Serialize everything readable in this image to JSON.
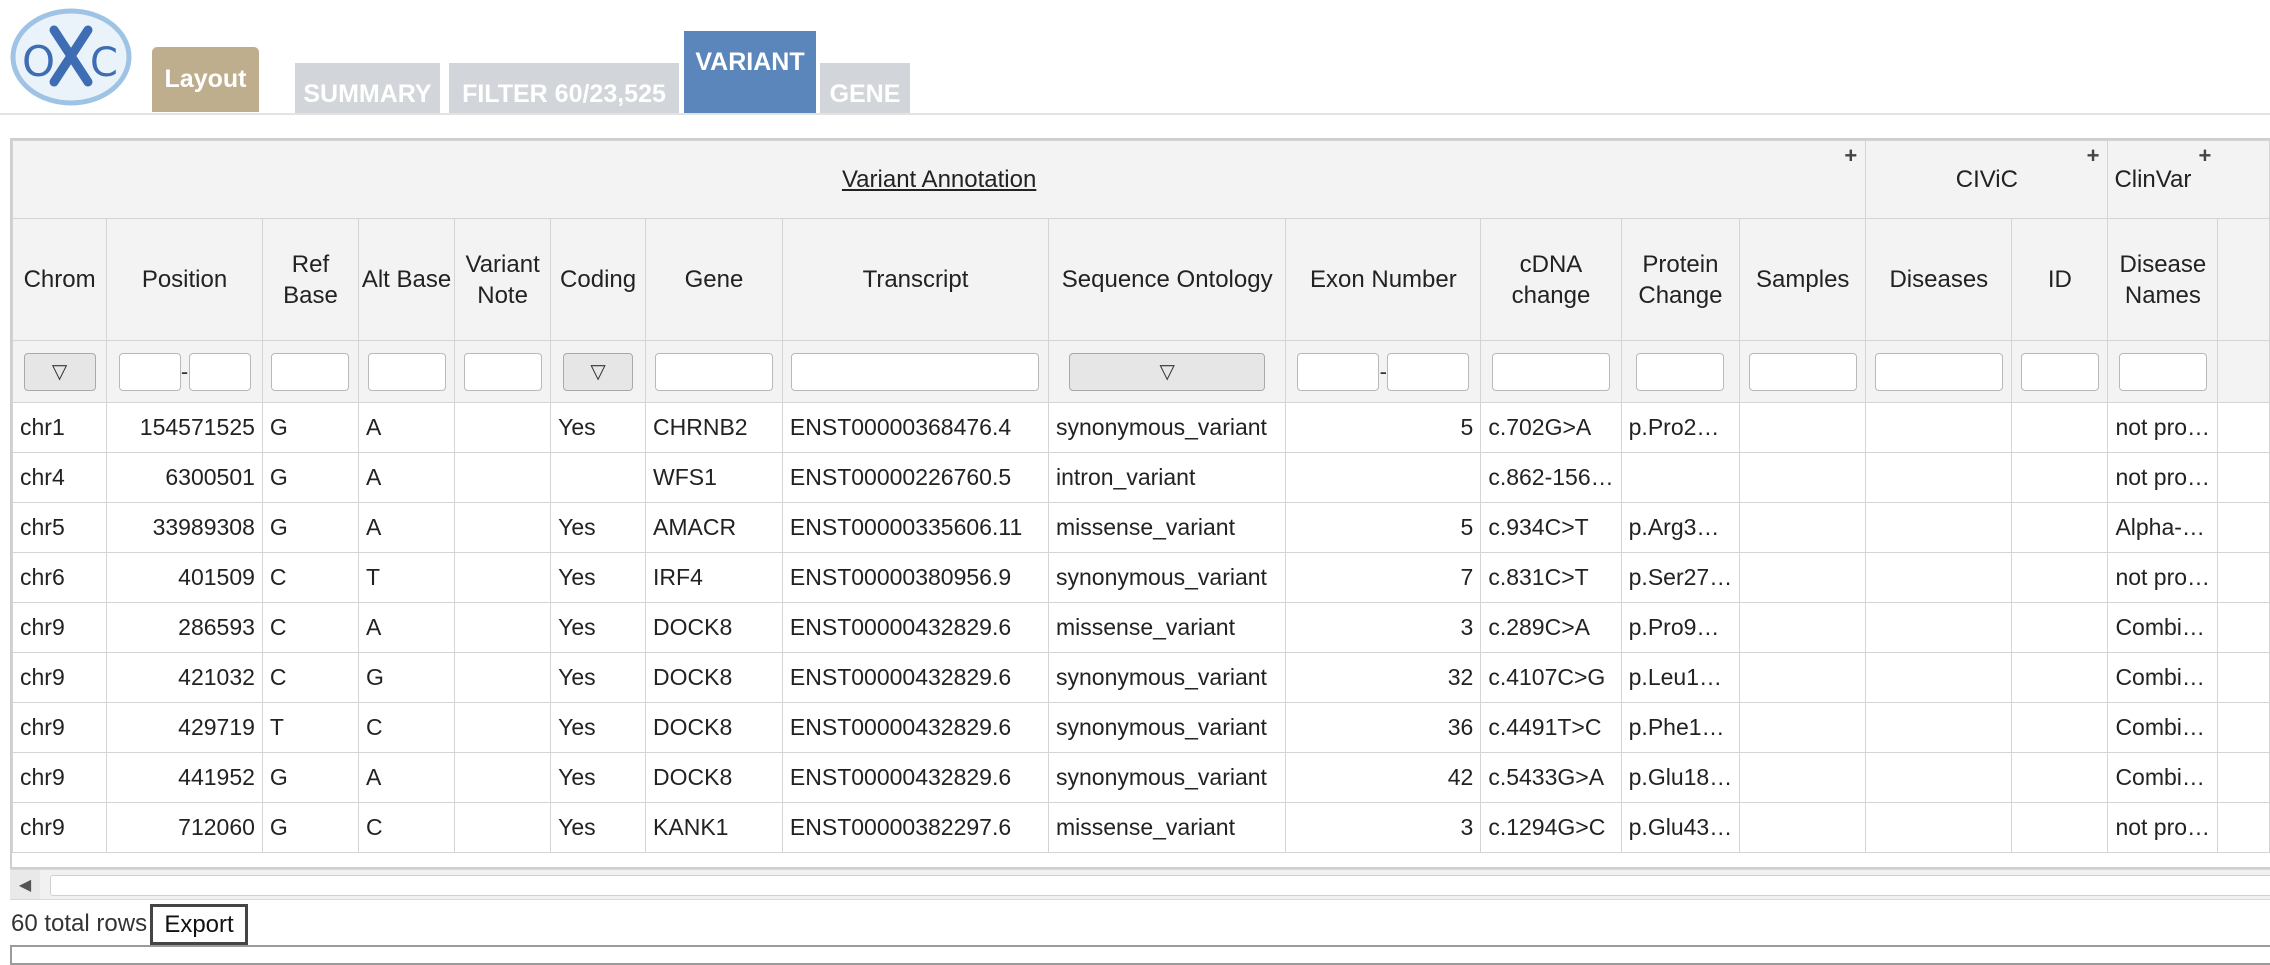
{
  "tabs": {
    "layout": "Layout",
    "summary": "SUMMARY",
    "filter": "FILTER 60/23,525",
    "variant": "VARIANT",
    "gene": "GENE"
  },
  "colors": {
    "layout_tab": "#bfae8e",
    "active_tab": "#5a86bb",
    "inactive_tab": "#d2d5d9",
    "logo_accent": "#3e6db3"
  },
  "groups": {
    "variant_annotation": "Variant Annotation",
    "civic": "CIViC",
    "clinvar": "ClinVar",
    "expand_icon": "+"
  },
  "columns": {
    "chrom": "Chrom",
    "position": "Position",
    "ref_base": "Ref Base",
    "alt_base": "Alt Base",
    "variant_note": "Variant Note",
    "coding": "Coding",
    "gene": "Gene",
    "transcript": "Transcript",
    "sequence_ontology": "Sequence Ontology",
    "exon_number": "Exon Number",
    "cdna_change": "cDNA change",
    "protein_change": "Protein Change",
    "samples": "Samples",
    "civic_diseases": "Diseases",
    "civic_id": "ID",
    "clinvar_disease_names": "Disease Names"
  },
  "filters": {
    "dropdown_icon": "▽",
    "range_separator": "-"
  },
  "rows": [
    {
      "chrom": "chr1",
      "position": "154571525",
      "ref": "G",
      "alt": "A",
      "note": "",
      "coding": "Yes",
      "gene": "CHRNB2",
      "transcript": "ENST00000368476.4",
      "so": "synonymous_variant",
      "exon": "5",
      "cdna": "c.702G>A",
      "protein": "p.Pro2…",
      "samples": "",
      "civic_diseases": "",
      "civic_id": "",
      "clinvar": "not pro…"
    },
    {
      "chrom": "chr4",
      "position": "6300501",
      "ref": "G",
      "alt": "A",
      "note": "",
      "coding": "",
      "gene": "WFS1",
      "transcript": "ENST00000226760.5",
      "so": "intron_variant",
      "exon": "",
      "cdna": "c.862-156…",
      "protein": "",
      "samples": "",
      "civic_diseases": "",
      "civic_id": "",
      "clinvar": "not pro…"
    },
    {
      "chrom": "chr5",
      "position": "33989308",
      "ref": "G",
      "alt": "A",
      "note": "",
      "coding": "Yes",
      "gene": "AMACR",
      "transcript": "ENST00000335606.11",
      "so": "missense_variant",
      "exon": "5",
      "cdna": "c.934C>T",
      "protein": "p.Arg3…",
      "samples": "",
      "civic_diseases": "",
      "civic_id": "",
      "clinvar": "Alpha-…"
    },
    {
      "chrom": "chr6",
      "position": "401509",
      "ref": "C",
      "alt": "T",
      "note": "",
      "coding": "Yes",
      "gene": "IRF4",
      "transcript": "ENST00000380956.9",
      "so": "synonymous_variant",
      "exon": "7",
      "cdna": "c.831C>T",
      "protein": "p.Ser27…",
      "samples": "",
      "civic_diseases": "",
      "civic_id": "",
      "clinvar": "not pro…"
    },
    {
      "chrom": "chr9",
      "position": "286593",
      "ref": "C",
      "alt": "A",
      "note": "",
      "coding": "Yes",
      "gene": "DOCK8",
      "transcript": "ENST00000432829.6",
      "so": "missense_variant",
      "exon": "3",
      "cdna": "c.289C>A",
      "protein": "p.Pro9…",
      "samples": "",
      "civic_diseases": "",
      "civic_id": "",
      "clinvar": "Combi…"
    },
    {
      "chrom": "chr9",
      "position": "421032",
      "ref": "C",
      "alt": "G",
      "note": "",
      "coding": "Yes",
      "gene": "DOCK8",
      "transcript": "ENST00000432829.6",
      "so": "synonymous_variant",
      "exon": "32",
      "cdna": "c.4107C>G",
      "protein": "p.Leu1…",
      "samples": "",
      "civic_diseases": "",
      "civic_id": "",
      "clinvar": "Combi…"
    },
    {
      "chrom": "chr9",
      "position": "429719",
      "ref": "T",
      "alt": "C",
      "note": "",
      "coding": "Yes",
      "gene": "DOCK8",
      "transcript": "ENST00000432829.6",
      "so": "synonymous_variant",
      "exon": "36",
      "cdna": "c.4491T>C",
      "protein": "p.Phe1…",
      "samples": "",
      "civic_diseases": "",
      "civic_id": "",
      "clinvar": "Combi…"
    },
    {
      "chrom": "chr9",
      "position": "441952",
      "ref": "G",
      "alt": "A",
      "note": "",
      "coding": "Yes",
      "gene": "DOCK8",
      "transcript": "ENST00000432829.6",
      "so": "synonymous_variant",
      "exon": "42",
      "cdna": "c.5433G>A",
      "protein": "p.Glu18…",
      "samples": "",
      "civic_diseases": "",
      "civic_id": "",
      "clinvar": "Combi…"
    },
    {
      "chrom": "chr9",
      "position": "712060",
      "ref": "G",
      "alt": "C",
      "note": "",
      "coding": "Yes",
      "gene": "KANK1",
      "transcript": "ENST00000382297.6",
      "so": "missense_variant",
      "exon": "3",
      "cdna": "c.1294G>C",
      "protein": "p.Glu43…",
      "samples": "",
      "civic_diseases": "",
      "civic_id": "",
      "clinvar": "not pro…"
    }
  ],
  "footer": {
    "total_rows": "60 total rows",
    "export_label": "Export",
    "scroll_left_icon": "◀"
  }
}
